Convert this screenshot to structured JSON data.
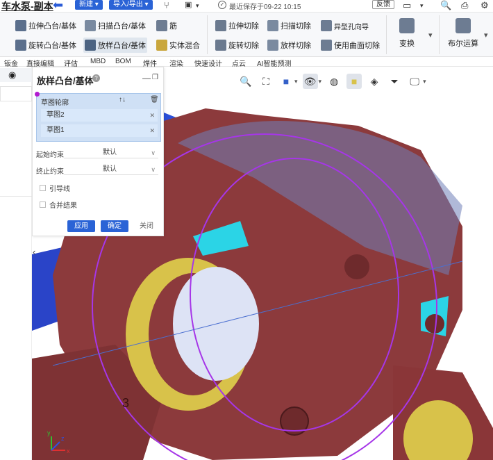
{
  "app": {
    "title": "车水泵-副本",
    "new_button": "新建",
    "import_export_button": "导入/导出",
    "save_status": "最近保存于09-22 10:15",
    "feedback_button": "反馈"
  },
  "ribbon": {
    "row1": [
      "拉伸凸台/基体",
      "扫描凸台/基体",
      "筋",
      "拉伸切除",
      "扫描切除",
      "异型孔向导"
    ],
    "row2": [
      "旋转凸台/基体",
      "放样凸台/基体",
      "实体混合",
      "旋转切除",
      "放样切除",
      "使用曲面切除"
    ],
    "transform_label": "变换",
    "boolean_label": "布尔运算"
  },
  "tabs": [
    "钣金",
    "直接编辑",
    "评估",
    "MBD",
    "BOM",
    "焊件",
    "渲染",
    "快速设计",
    "点云",
    "AI智能预测"
  ],
  "panel": {
    "title": "放样凸台/基体",
    "profile_label": "草图轮廓",
    "sketches": [
      "草图2",
      "草图1"
    ],
    "start_constraint_label": "起始约束",
    "start_constraint_value": "默认",
    "end_constraint_label": "终止约束",
    "end_constraint_value": "默认",
    "guide_line_label": "引导线",
    "merge_result_label": "合并结果",
    "apply_button": "应用",
    "ok_button": "确定",
    "close_button": "关闭"
  },
  "viewport": {
    "model_text": "3",
    "axis_x": "x",
    "axis_y": "y",
    "axis_z": "z"
  },
  "colors": {
    "accent": "#2a63d6",
    "model_body": "#8c3a3c",
    "model_highlight": "#d8c24a",
    "profile_outline": "#a636e8",
    "blue_face": "#2b4fd8",
    "cyan_face": "#2bd4e6"
  }
}
